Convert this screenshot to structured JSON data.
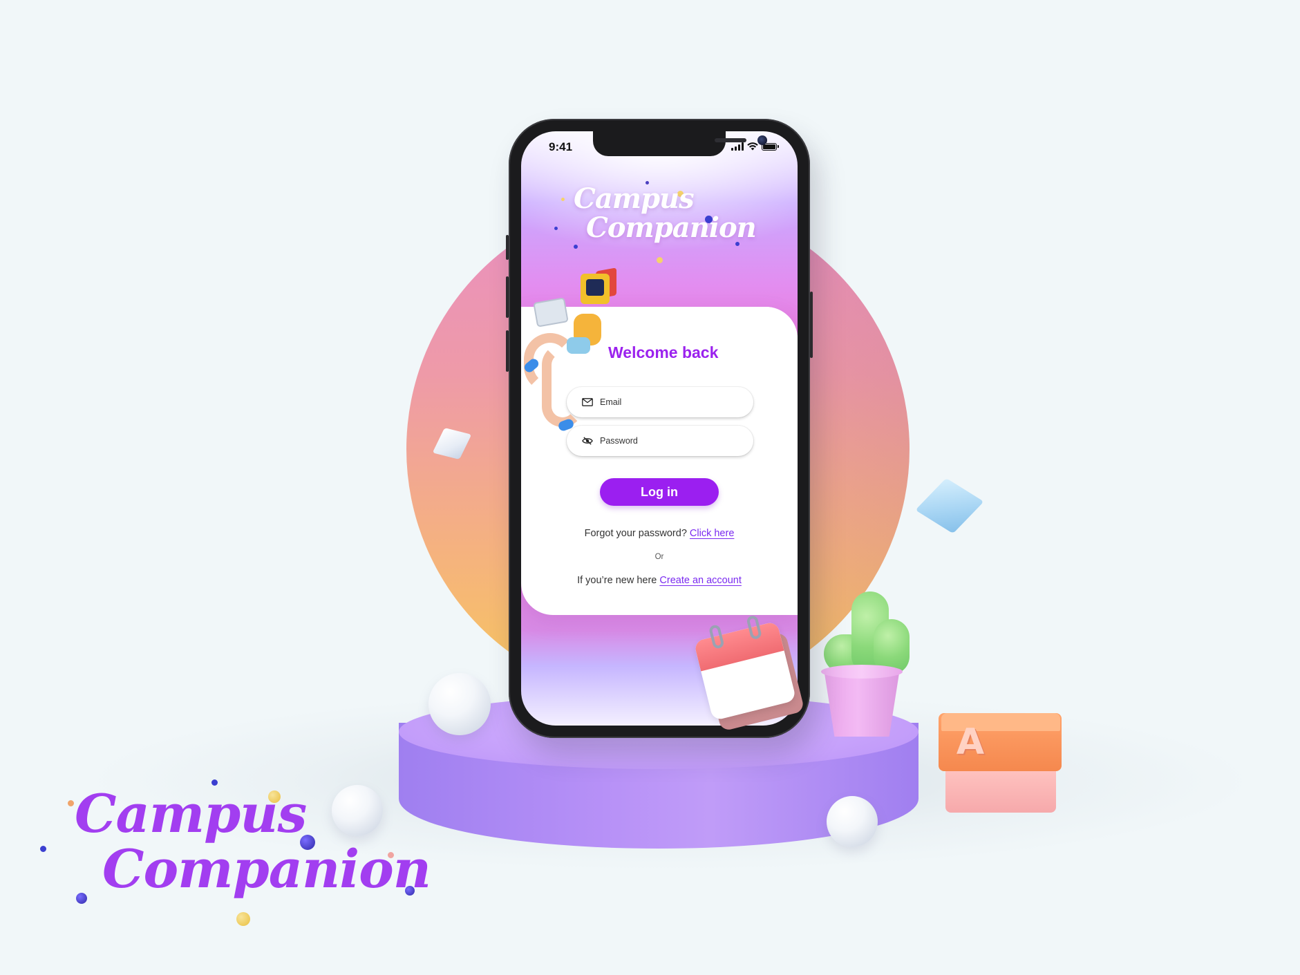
{
  "brand": {
    "name_line1": "Campus",
    "name_line2": "Companion",
    "primary_color": "#9b1ff0",
    "accent_color": "#a23ef0"
  },
  "status_bar": {
    "time": "9:41",
    "icons": [
      "signal-icon",
      "wifi-icon",
      "battery-icon"
    ]
  },
  "login": {
    "heading": "Welcome back",
    "email_placeholder": "Email",
    "email_icon": "envelope-icon",
    "password_placeholder": "Password",
    "password_icon": "eye-slash-icon",
    "login_button": "Log in",
    "forgot_text": "Forgot your password?",
    "forgot_link": "Click here",
    "or_text": "Or",
    "new_text": "If you’re new here",
    "create_link": "Create an account"
  },
  "decor": {
    "block_letter": "A"
  }
}
